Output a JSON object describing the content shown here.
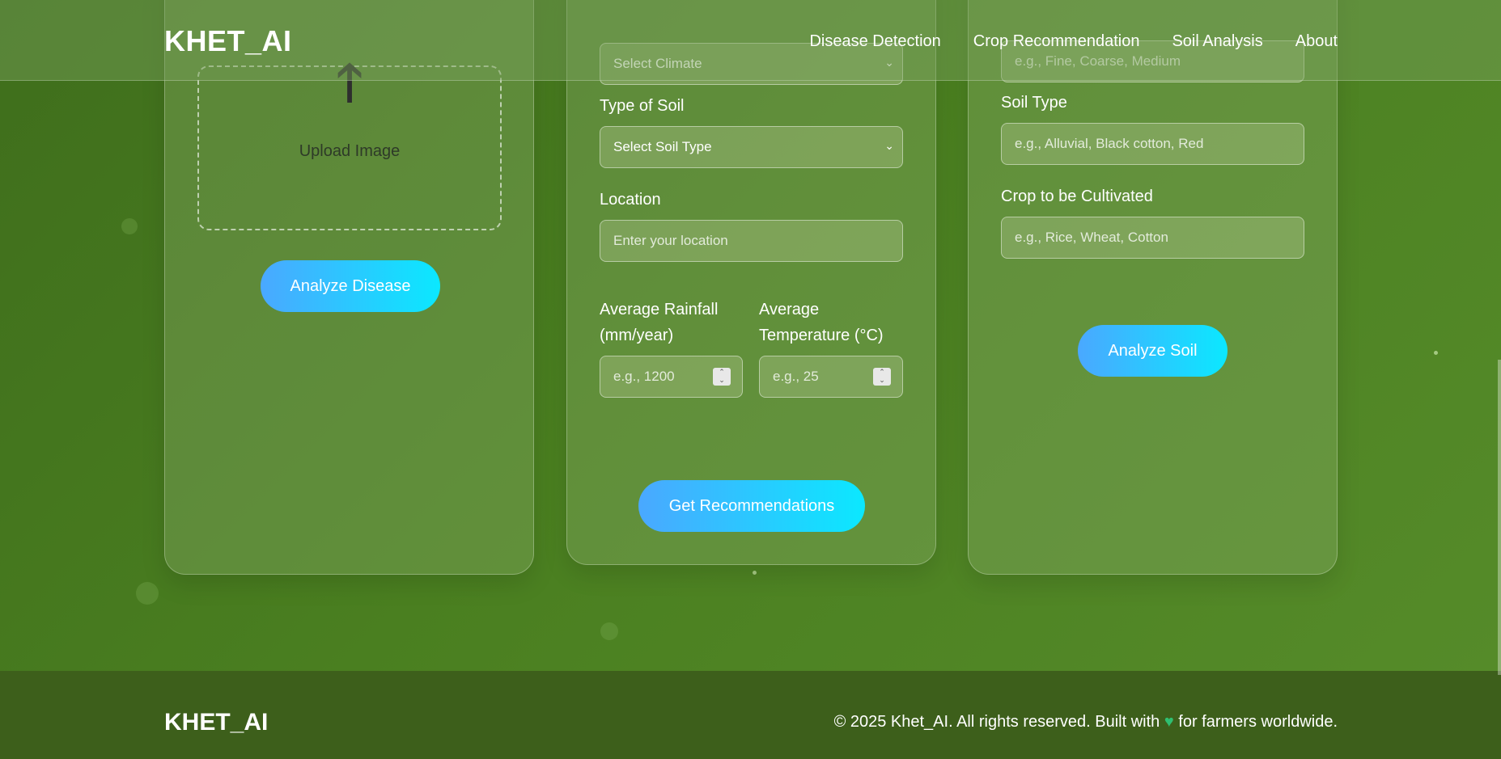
{
  "header": {
    "logo": "KHET_AI",
    "nav": [
      "Disease Detection",
      "Crop Recommendation",
      "Soil Analysis",
      "About"
    ]
  },
  "disease_card": {
    "upload_icon": "up-arrow-icon",
    "upload_label": "Upload Image",
    "button": "Analyze Disease"
  },
  "crop_card": {
    "climate_select": "Select Climate",
    "soil_label": "Type of Soil",
    "soil_select": "Select Soil Type",
    "location_label": "Location",
    "location_placeholder": "Enter your location",
    "rainfall_label_1": "Average Rainfall",
    "rainfall_label_2": "(mm/year)",
    "rainfall_placeholder": "e.g., 1200",
    "temp_label_1": "Average",
    "temp_label_2": "Temperature (°C)",
    "temp_placeholder": "e.g., 25",
    "button": "Get Recommendations"
  },
  "soil_card": {
    "texture_placeholder": "e.g., Fine, Coarse, Medium",
    "soil_type_label": "Soil Type",
    "soil_type_placeholder": "e.g., Alluvial, Black cotton, Red",
    "crop_label": "Crop to be Cultivated",
    "crop_placeholder": "e.g., Rice, Wheat, Cotton",
    "button": "Analyze Soil"
  },
  "footer": {
    "logo": "KHET_AI",
    "text_before": "© 2025 Khet_AI. All rights reserved. Built with",
    "heart_icon": "green-heart-icon",
    "text_after": "for farmers worldwide."
  }
}
